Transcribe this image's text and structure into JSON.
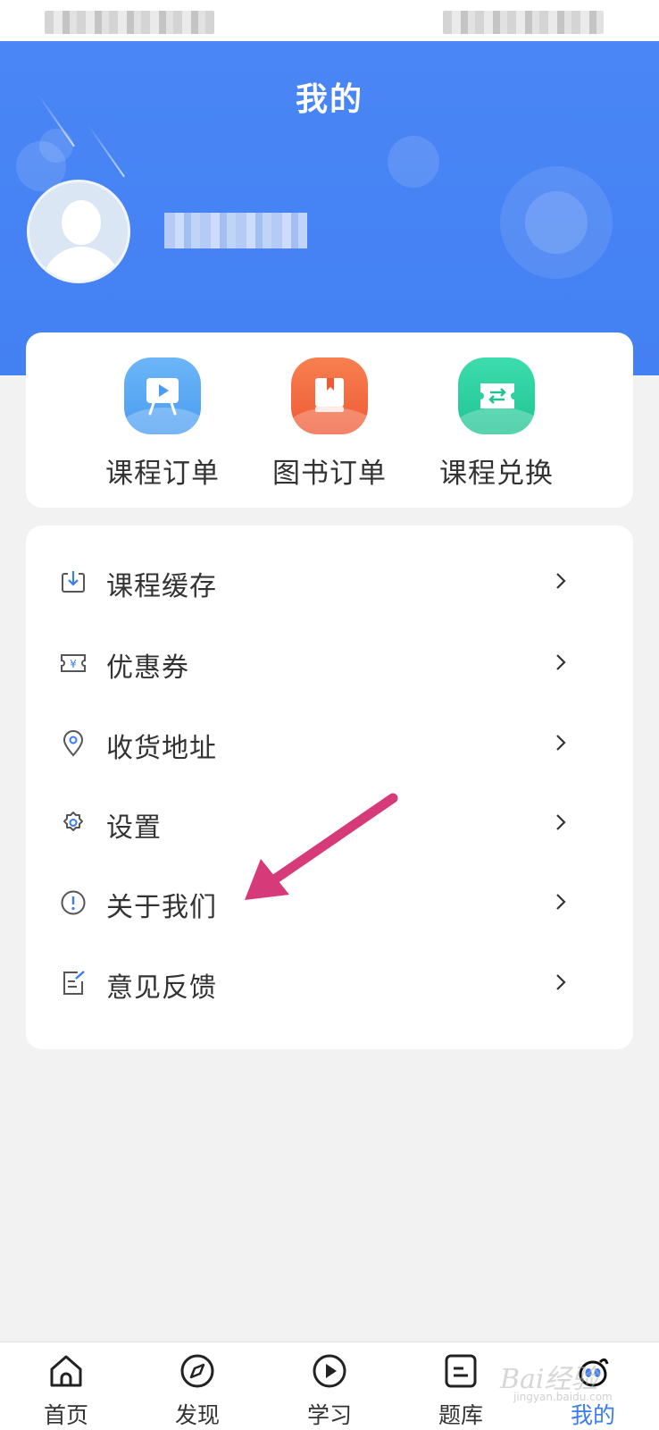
{
  "header": {
    "title": "我的"
  },
  "quick_actions": [
    {
      "label": "课程订单",
      "icon": "play-board-icon",
      "color": "#5aaaf5"
    },
    {
      "label": "图书订单",
      "icon": "book-icon",
      "color": "#f36b43"
    },
    {
      "label": "课程兑换",
      "icon": "exchange-ticket-icon",
      "color": "#2ad09f"
    }
  ],
  "menu": [
    {
      "label": "课程缓存",
      "icon": "download-icon"
    },
    {
      "label": "优惠券",
      "icon": "coupon-icon"
    },
    {
      "label": "收货地址",
      "icon": "location-pin-icon"
    },
    {
      "label": "设置",
      "icon": "gear-icon"
    },
    {
      "label": "关于我们",
      "icon": "info-circle-icon"
    },
    {
      "label": "意见反馈",
      "icon": "feedback-edit-icon"
    }
  ],
  "bottom_nav": [
    {
      "label": "首页",
      "icon": "home-icon",
      "active": false
    },
    {
      "label": "发现",
      "icon": "compass-icon",
      "active": false
    },
    {
      "label": "学习",
      "icon": "play-circle-icon",
      "active": false
    },
    {
      "label": "题库",
      "icon": "question-bank-icon",
      "active": false
    },
    {
      "label": "我的",
      "icon": "profile-icon",
      "active": true
    }
  ],
  "colors": {
    "brand_blue": "#4380f2",
    "active_tab": "#3a7cf2",
    "annotation_arrow": "#d63a79"
  },
  "watermark": {
    "brand": "Bai经验",
    "sub": "jingyan.baidu.com"
  }
}
